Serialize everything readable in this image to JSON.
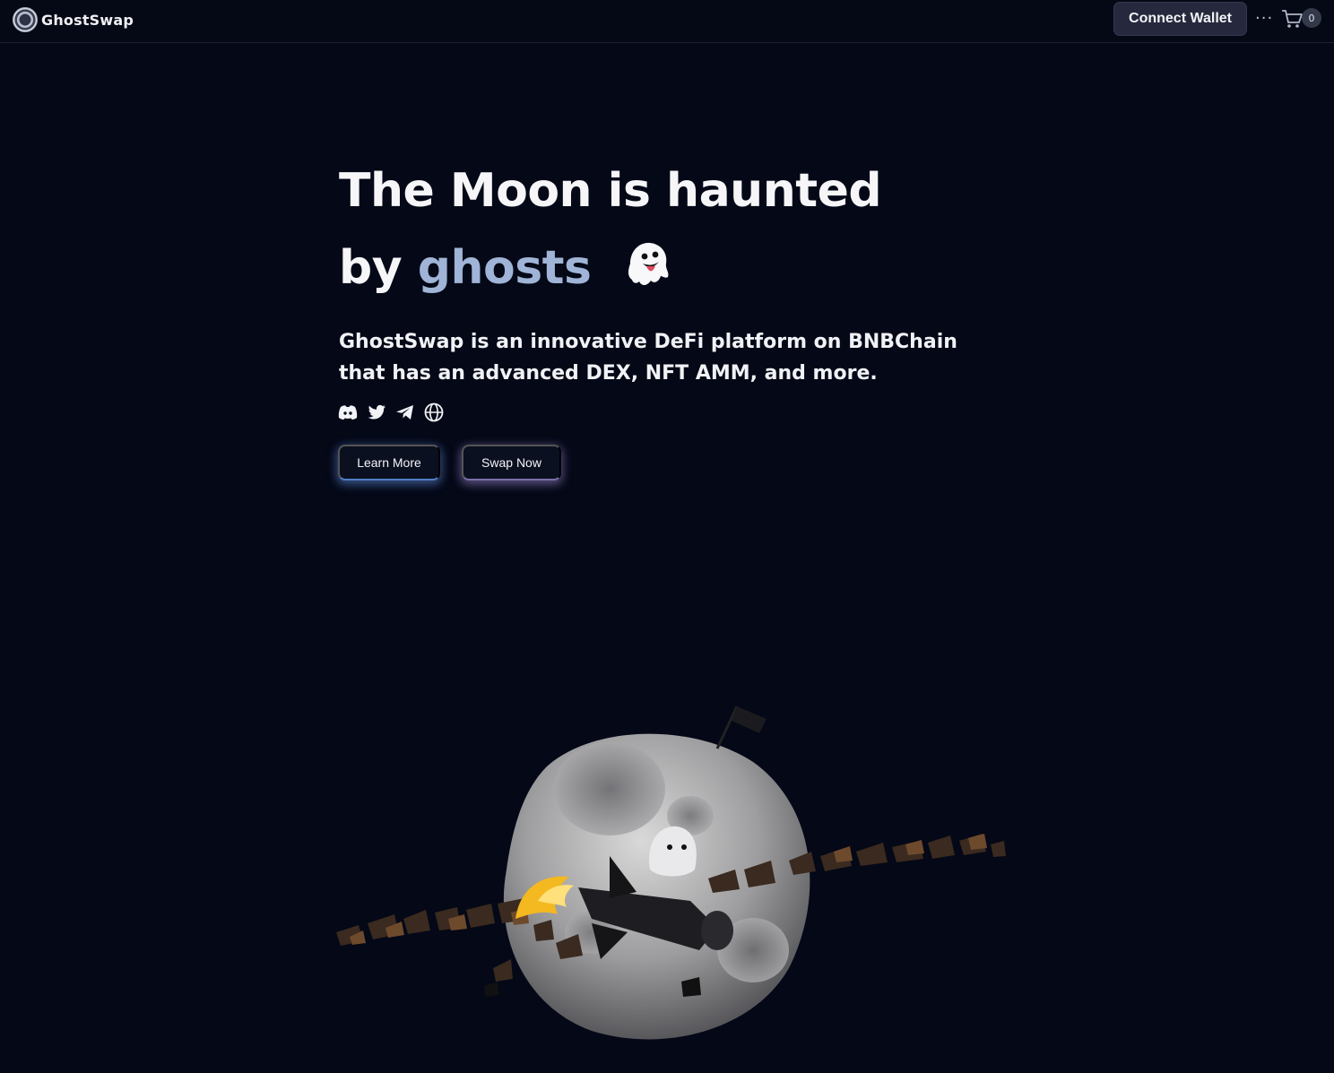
{
  "header": {
    "brand_name": "GhostSwap",
    "connect_wallet_label": "Connect Wallet",
    "more_label": "···",
    "cart_count": "0"
  },
  "hero": {
    "title_line1": "The Moon is haunted",
    "title_line2_prefix": "by",
    "title_line2_accent": "ghosts",
    "description": "GhostSwap is an innovative DeFi platform on BNBChain that has an advanced DEX, NFT AMM, and more.",
    "learn_more_label": "Learn More",
    "swap_now_label": "Swap Now"
  },
  "icons": {
    "social": [
      "discord-icon",
      "twitter-icon",
      "telegram-icon",
      "globe-icon"
    ],
    "header": [
      "ghostswap-logo",
      "more-icon",
      "cart-icon"
    ],
    "hero": [
      "ghost-emoji-icon"
    ]
  },
  "colors": {
    "background": "#040817",
    "accent": "#9fb4d6",
    "button_bg": "#26293d",
    "learn_glow": "#5c87d2",
    "swap_glow": "#9682c8"
  }
}
